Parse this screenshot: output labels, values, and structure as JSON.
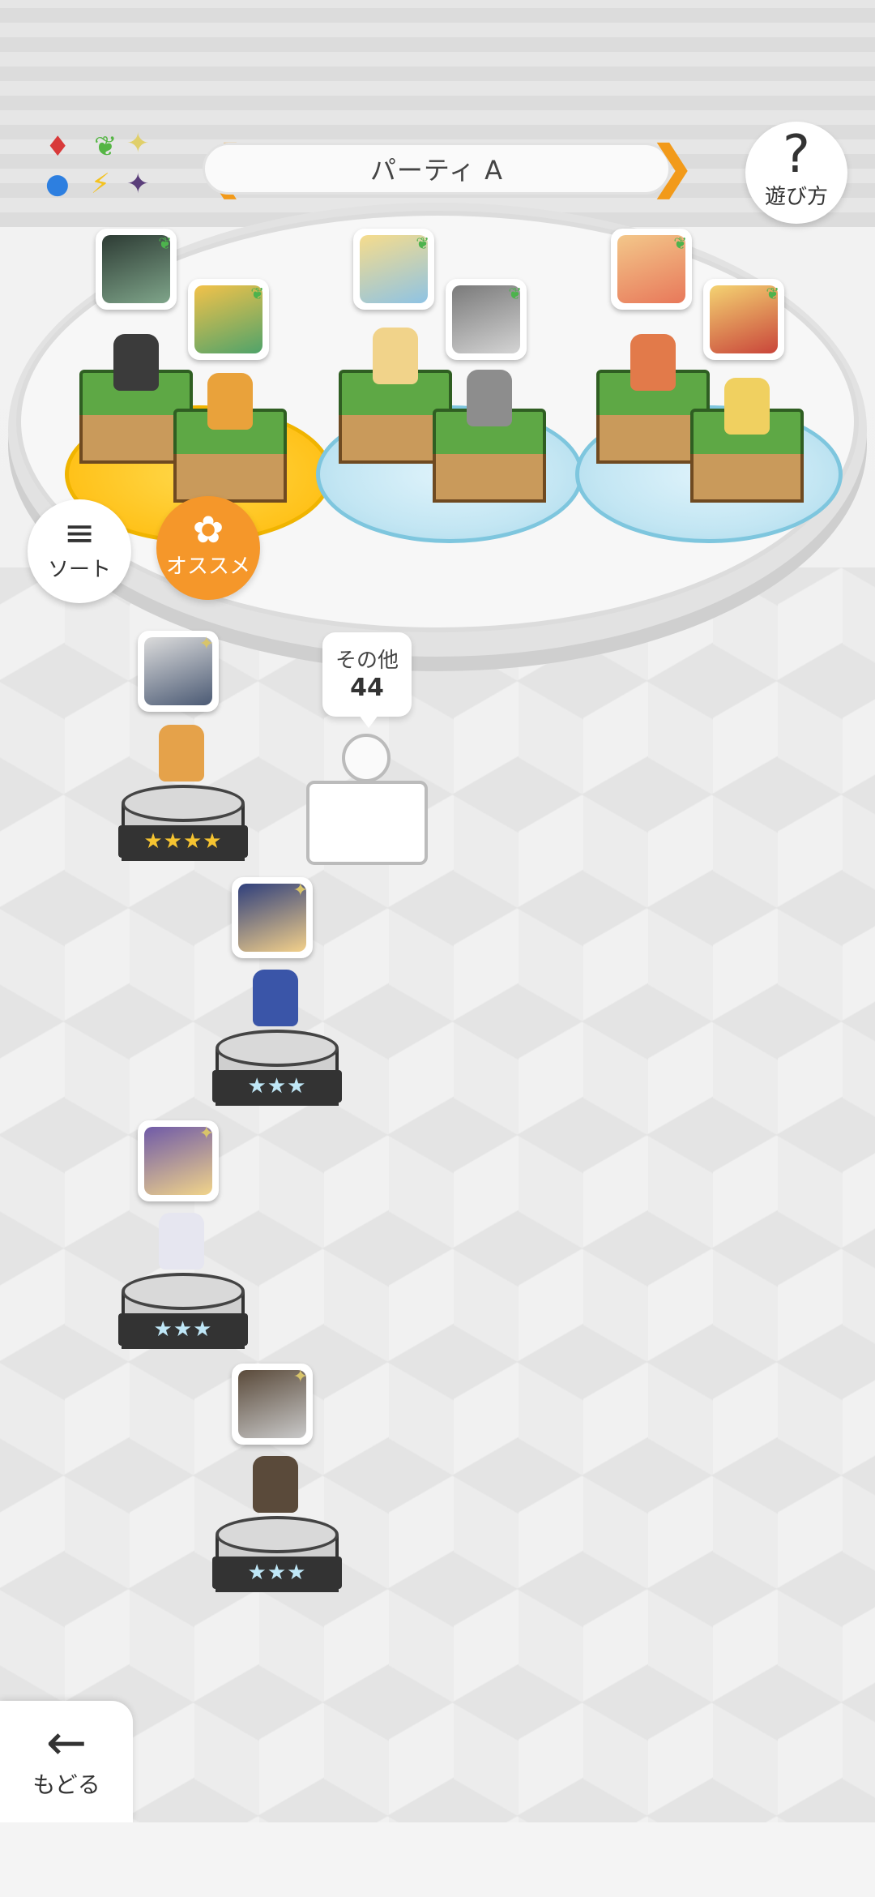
{
  "header": {
    "party_title": "パーティ A",
    "help_label": "遊び方",
    "help_symbol": "?",
    "prev_symbol": "❮",
    "next_symbol": "❯"
  },
  "element_chart": {
    "symbols": [
      "♦",
      "◆",
      "❦",
      "✦",
      "●",
      "◀",
      "⚡",
      "✦"
    ],
    "icons": [
      "fire-element-icon",
      "grass-element-icon",
      "light-element-icon",
      "water-element-icon",
      "thunder-element-icon",
      "dark-element-icon"
    ]
  },
  "controls": {
    "sort_label": "ソート",
    "sort_icon": "≡",
    "recommend_label": "オススメ",
    "recommend_icon": "✿",
    "back_label": "もどる",
    "back_icon": "←"
  },
  "others": {
    "label": "その他",
    "count": "44"
  },
  "roster": [
    {
      "stars": "★★★★",
      "rarity": "gold"
    },
    {
      "stars": "★★★",
      "rarity": "blue"
    },
    {
      "stars": "★★★",
      "rarity": "blue"
    },
    {
      "stars": "★★★",
      "rarity": "blue"
    }
  ],
  "colors": {
    "accent_orange": "#f5972a",
    "grass_badge": "#4db34d",
    "gold_stars": "#f6c431",
    "blue_stars": "#bfe7f7"
  }
}
